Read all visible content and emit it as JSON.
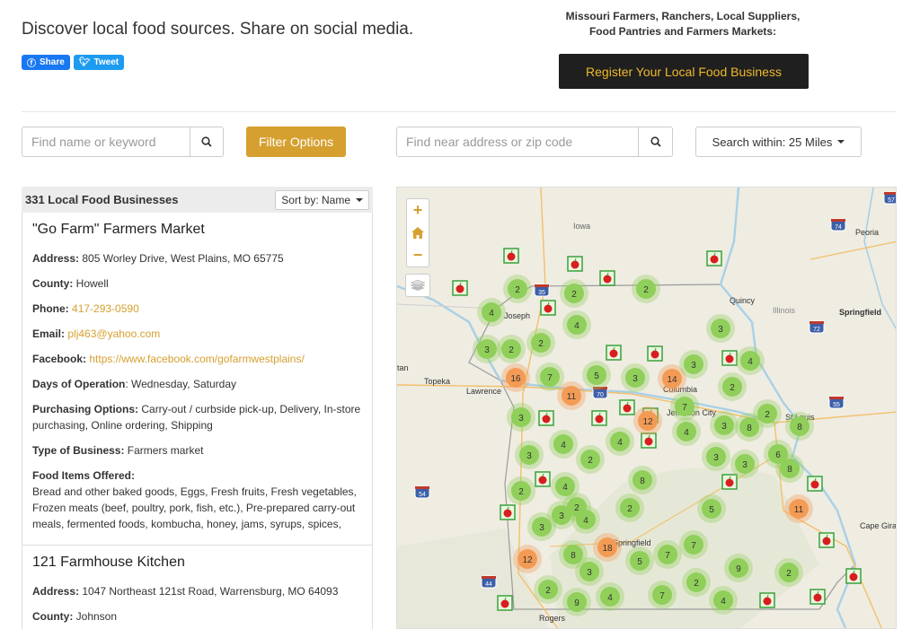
{
  "header": {
    "tagline": "Discover local food sources. Share on social media.",
    "share_label": "Share",
    "tweet_label": "Tweet",
    "promo_line1": "Missouri Farmers, Ranchers, Local Suppliers,",
    "promo_line2": "Food Pantries and Farmers Markets:",
    "register_label": "Register Your Local Food Business"
  },
  "search": {
    "keyword_placeholder": "Find name or keyword",
    "filter_label": "Filter Options",
    "address_placeholder": "Find near address or zip code",
    "within_label": "Search within: 25 Miles"
  },
  "list": {
    "count_label": "331 Local Food Businesses",
    "sort_label": "Sort by: Name",
    "items": [
      {
        "name": "\"Go Farm\" Farmers Market",
        "address_label": "Address:",
        "address": " 805 Worley Drive, West Plains, MO 65775",
        "county_label": "County:",
        "county": " Howell",
        "phone_label": "Phone:",
        "phone": "417-293-0590",
        "email_label": "Email:",
        "email": "plj463@yahoo.com",
        "facebook_label": "Facebook:",
        "facebook": "https://www.facebook.com/gofarmwestplains/",
        "days_label": "Days of Operation",
        "days": ": Wednesday, Saturday",
        "purchasing_label": "Purchasing Options:",
        "purchasing": " Carry-out / curbside pick-up, Delivery, In-store purchasing, Online ordering, Shipping",
        "type_label": "Type of Business:",
        "type": " Farmers market",
        "food_label": "Food Items Offered:",
        "food": "Bread and other baked goods, Eggs, Fresh fruits, Fresh vegetables, Frozen meats (beef, poultry, pork, fish, etc.), Pre-prepared carry-out meals, fermented foods, kombucha, honey, jams, syrups, spices,"
      },
      {
        "name": "121 Farmhouse Kitchen",
        "address_label": "Address:",
        "address": " 1047 Northeast 121st Road, Warrensburg, MO 64093",
        "county_label": "County:",
        "county": " Johnson"
      }
    ]
  },
  "map": {
    "colors": {
      "land": "#efece2",
      "water": "#a9d0e6",
      "cluster_green": "#8fcf5a",
      "cluster_orange": "#f39b55",
      "marker": "#3aa13a",
      "apple": "#d81e1e"
    },
    "places": [
      "Iowa",
      "Peoria",
      "Quincy",
      "Illinois",
      "Springfield",
      "Topeka",
      "Lawrence",
      "Columbia",
      "St Louis",
      "Jefferson City",
      "Cape Girardeau",
      "Springfield",
      "Rogers",
      "Joseph",
      "tan"
    ],
    "clusters": [
      "2",
      "2",
      "2",
      "4",
      "4",
      "3",
      "2",
      "2",
      "3",
      "16",
      "7",
      "11",
      "5",
      "3",
      "14",
      "3",
      "4",
      "2",
      "7",
      "3",
      "12",
      "4",
      "3",
      "8",
      "2",
      "8",
      "3",
      "4",
      "4",
      "2",
      "3",
      "3",
      "6",
      "8",
      "2",
      "4",
      "8",
      "3",
      "4",
      "5",
      "2",
      "3",
      "11",
      "7",
      "12",
      "8",
      "18",
      "5",
      "7",
      "3",
      "9",
      "2",
      "2",
      "9",
      "4",
      "7",
      "2",
      "4",
      "2"
    ],
    "shields": [
      "35",
      "70",
      "44",
      "55",
      "72",
      "74",
      "57",
      "54"
    ]
  }
}
